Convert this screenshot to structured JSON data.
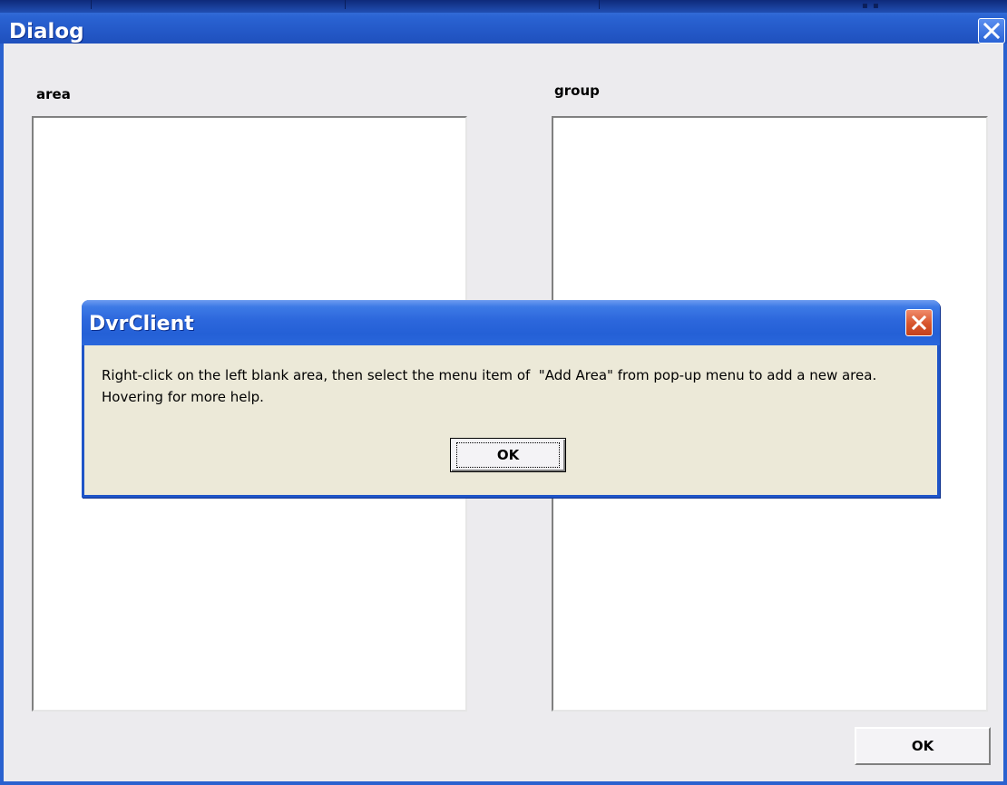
{
  "background": {
    "strip_glyphs": "▪ ▪"
  },
  "dialog": {
    "title": "Dialog",
    "close_icon": "close-x-icon",
    "area_label": "area",
    "group_label": "group",
    "ok_label": "OK",
    "colors": {
      "titlebar": "#2a63d2",
      "frame": "#2a61cf",
      "body": "#ecebee"
    }
  },
  "message_box": {
    "title": "DvrClient",
    "close_icon": "close-x-icon",
    "text": "Right-click on the left blank area, then select the menu item of  \"Add Area\" from pop-up menu to add a new area. Hovering for more help.",
    "ok_label": "OK",
    "colors": {
      "titlebar": "#2c67dc",
      "close_button": "#d7552d",
      "body": "#ece9d8"
    }
  }
}
